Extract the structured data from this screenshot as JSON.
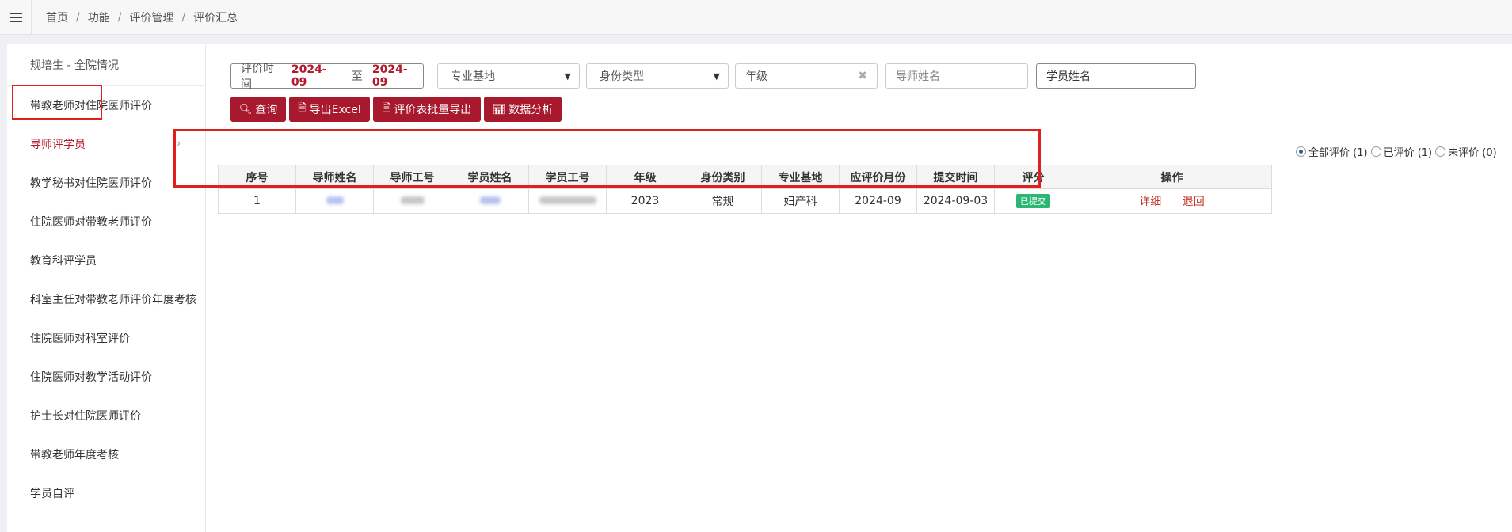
{
  "breadcrumb": [
    "首页",
    "功能",
    "评价管理",
    "评价汇总"
  ],
  "sidebar": {
    "header": "规培生 - 全院情况",
    "items": [
      {
        "label": "带教老师对住院医师评价"
      },
      {
        "label": "导师评学员",
        "active": true
      },
      {
        "label": "教学秘书对住院医师评价"
      },
      {
        "label": "住院医师对带教老师评价"
      },
      {
        "label": "教育科评学员"
      },
      {
        "label": "科室主任对带教老师评价年度考核"
      },
      {
        "label": "住院医师对科室评价"
      },
      {
        "label": "住院医师对教学活动评价"
      },
      {
        "label": "护士长对住院医师评价"
      },
      {
        "label": "带教老师年度考核"
      },
      {
        "label": "学员自评"
      }
    ]
  },
  "filters": {
    "date_label": "评价时间",
    "date_from": "2024-09",
    "date_to_sep": "至",
    "date_to": "2024-09",
    "specialty_placeholder": "专业基地",
    "identity_placeholder": "身份类型",
    "grade_placeholder": "年级",
    "tutor_placeholder": "导师姓名",
    "student_value": "学员姓名"
  },
  "buttons": {
    "query": "查询",
    "export_excel": "导出Excel",
    "batch_export": "评价表批量导出",
    "analysis": "数据分析"
  },
  "radios": [
    {
      "label": "全部评价 (1)",
      "checked": true
    },
    {
      "label": "已评价 (1)",
      "checked": false
    },
    {
      "label": "未评价 (0)",
      "checked": false
    }
  ],
  "table": {
    "headers": [
      "序号",
      "导师姓名",
      "导师工号",
      "学员姓名",
      "学员工号",
      "年级",
      "身份类别",
      "专业基地",
      "应评价月份",
      "提交时间",
      "评分",
      "操作"
    ],
    "rows": [
      {
        "index": "1",
        "grade": "2023",
        "identity": "常规",
        "specialty": "妇产科",
        "month": "2024-09",
        "submitted": "2024-09-03",
        "score_badge": "已提交",
        "actions": [
          "详细",
          "退回"
        ]
      }
    ]
  },
  "colors": {
    "brand": "#a8192e",
    "highlight_box": "#e02020",
    "badge_green": "#2bb673"
  }
}
